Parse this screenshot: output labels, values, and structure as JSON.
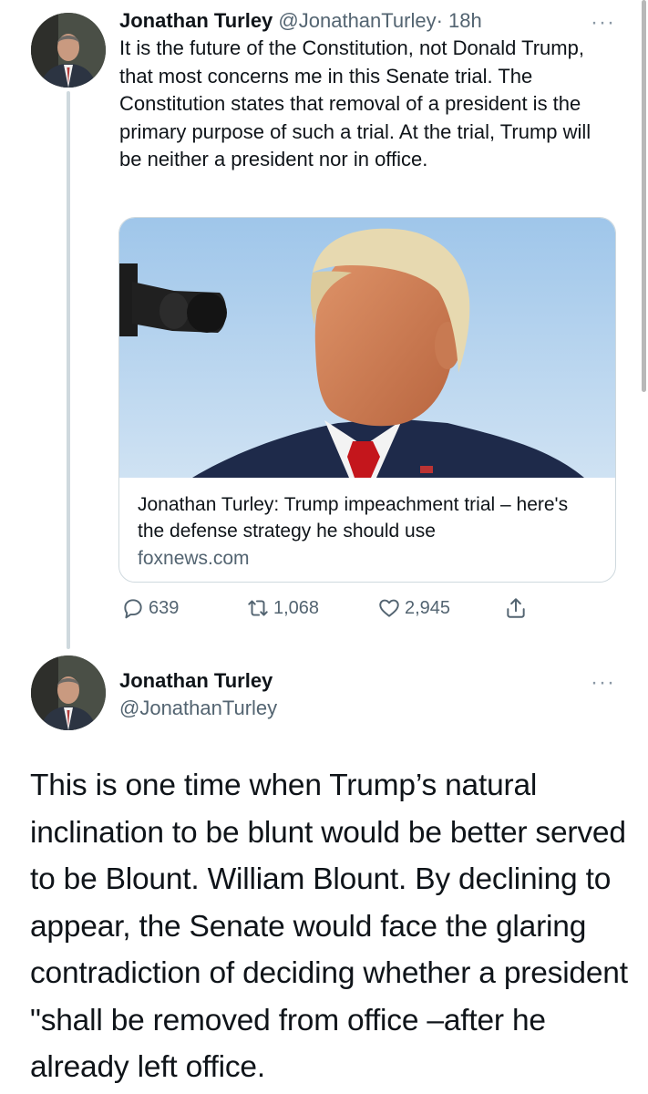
{
  "tweet1": {
    "author_name": "Jonathan Turley",
    "handle": "@JonathanTurley",
    "separator": "·",
    "time": "18h",
    "more": "···",
    "text": "It is the future of the Constitution, not Donald Trump, that most concerns me in this Senate trial. The Constitution  states that removal of a president is the primary purpose of such a trial. At the trial, Trump will be neither a president nor in office.",
    "card": {
      "title": "Jonathan Turley: Trump impeachment trial – here's the defense strategy he should use",
      "domain": "foxnews.com"
    },
    "actions": {
      "reply_count": "639",
      "retweet_count": "1,068",
      "like_count": "2,945"
    }
  },
  "tweet2": {
    "author_name": "Jonathan Turley",
    "handle": "@JonathanTurley",
    "more": "···",
    "text": "This is one time when Trump’s natural inclination to be blunt would be better served to be Blount. William Blount. By declining to appear, the Senate would face the glaring contradiction of deciding whether a president \"shall be removed from office –after he already left office."
  },
  "icons": {
    "reply": "reply-icon",
    "retweet": "retweet-icon",
    "like": "heart-icon",
    "share": "share-icon",
    "more": "more-icon"
  },
  "colors": {
    "text": "#0f1419",
    "muted": "#536471",
    "border": "#cfd9de"
  }
}
